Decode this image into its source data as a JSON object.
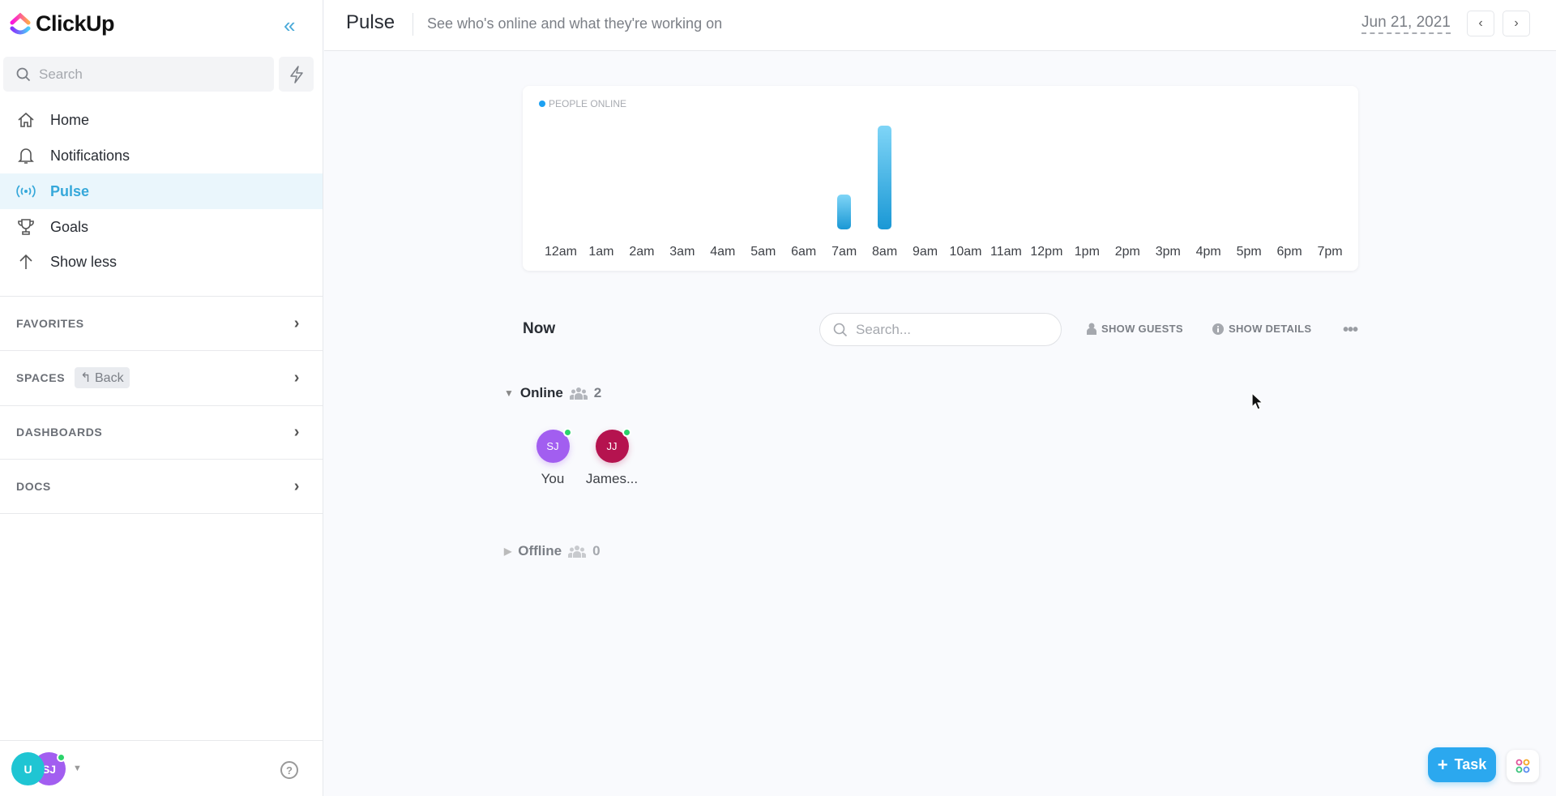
{
  "sidebar": {
    "brand": "ClickUp",
    "search_placeholder": "Search",
    "nav": [
      {
        "label": "Home",
        "icon": "home-icon"
      },
      {
        "label": "Notifications",
        "icon": "bell-icon"
      },
      {
        "label": "Pulse",
        "icon": "broadcast-icon",
        "active": true
      },
      {
        "label": "Goals",
        "icon": "trophy-icon"
      },
      {
        "label": "Show less",
        "icon": "arrow-up-icon"
      }
    ],
    "sections": [
      {
        "label": "FAVORITES"
      },
      {
        "label": "SPACES",
        "extra": "Back"
      },
      {
        "label": "DASHBOARDS"
      },
      {
        "label": "DOCS"
      }
    ],
    "user_avatars": [
      {
        "initials": "U",
        "color": "#1fc5d3"
      },
      {
        "initials": "SJ",
        "color": "#a25ef0"
      }
    ]
  },
  "header": {
    "title": "Pulse",
    "subtitle": "See who's online and what they're working on",
    "date": "Jun 21, 2021"
  },
  "chart_data": {
    "type": "bar",
    "legend": "PEOPLE ONLINE",
    "categories": [
      "12am",
      "1am",
      "2am",
      "3am",
      "4am",
      "5am",
      "6am",
      "7am",
      "8am",
      "9am",
      "10am",
      "11am",
      "12pm",
      "1pm",
      "2pm",
      "3pm",
      "4pm",
      "5pm",
      "6pm",
      "7pm"
    ],
    "values": [
      0,
      0,
      0,
      0,
      0,
      0,
      0,
      1,
      3,
      0,
      0,
      0,
      0,
      0,
      0,
      0,
      0,
      0,
      0,
      0
    ],
    "ylim": [
      0,
      3
    ],
    "color": "#1da1f2",
    "grid": false
  },
  "now": {
    "title": "Now",
    "search_placeholder": "Search...",
    "show_guests": "SHOW GUESTS",
    "show_details": "SHOW DETAILS",
    "online": {
      "label": "Online",
      "count": "2",
      "people": [
        {
          "initials": "SJ",
          "name": "You",
          "color": "#a25ef0"
        },
        {
          "initials": "JJ",
          "name": "James...",
          "color": "#b5134f"
        }
      ]
    },
    "offline": {
      "label": "Offline",
      "count": "0"
    }
  },
  "fab": {
    "task_label": "Task"
  }
}
